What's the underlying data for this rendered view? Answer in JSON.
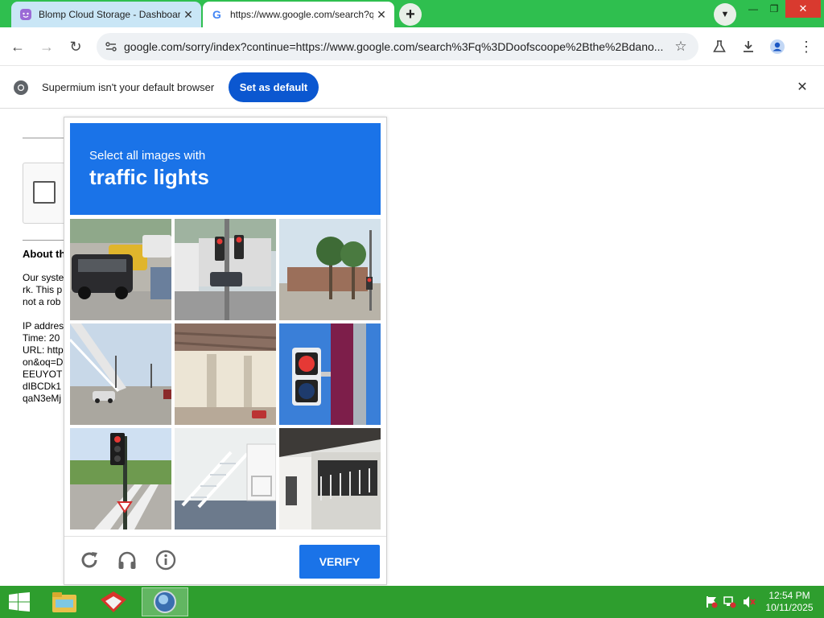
{
  "browser": {
    "tabs": [
      {
        "title": "Blomp Cloud Storage - Dashboard",
        "active": false
      },
      {
        "title": "https://www.google.com/search?q=...",
        "active": true
      }
    ],
    "url": "google.com/sorry/index?continue=https://www.google.com/search%3Fq%3DDoofscoope%2Bthe%2Bdano...",
    "infobar": {
      "message": "Supermium isn't your default browser",
      "button": "Set as default"
    }
  },
  "sorry_page": {
    "heading": "About th",
    "lines": "Our syste\nrk. This p\nnot a rob\n\nIP addres\nTime: 20\nURL: http\non&oq=D\nEEUYOT\ndIBCDk1\nqaN3eMj"
  },
  "captcha": {
    "prompt_line1": "Select all images with",
    "prompt_line2": "traffic lights",
    "verify_label": "VERIFY",
    "tiles": [
      "cars-parking-lot",
      "traffic-light-intersection",
      "palm-trees-street",
      "bridge-road",
      "overpass-underside",
      "pedestrian-signal-closeup",
      "traffic-light-crosswalk",
      "white-stairs-house",
      "building-balcony"
    ]
  },
  "taskbar": {
    "time": "12:54 PM",
    "date": "10/11/2025"
  },
  "colors": {
    "tab_strip": "#2fbf4f",
    "captcha_blue": "#1a73e8",
    "taskbar": "#2e9e2e"
  }
}
